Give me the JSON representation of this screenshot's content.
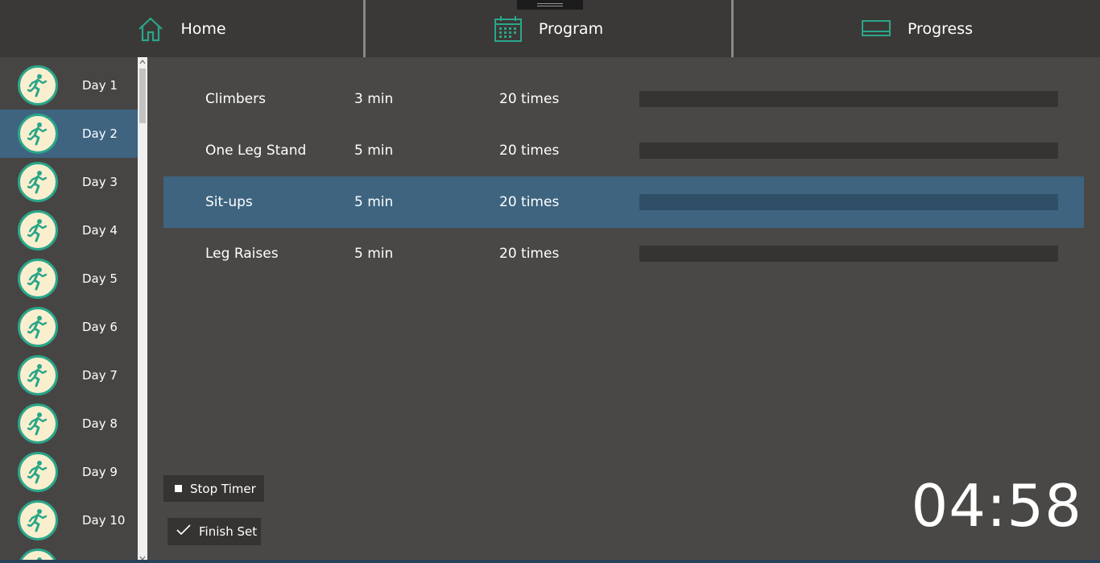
{
  "nav": {
    "tabs": [
      {
        "label": "Home",
        "icon": "home-icon"
      },
      {
        "label": "Program",
        "icon": "calendar-icon"
      },
      {
        "label": "Progress",
        "icon": "progress-icon"
      }
    ],
    "accent_color": "#2aa68a"
  },
  "sidebar": {
    "selected_index": 1,
    "items": [
      {
        "label": "Day 1",
        "icon": "runner-icon"
      },
      {
        "label": "Day 2",
        "icon": "runner-icon"
      },
      {
        "label": "Day 3",
        "icon": "runner-icon"
      },
      {
        "label": "Day 4",
        "icon": "runner-icon"
      },
      {
        "label": "Day 5",
        "icon": "runner-icon"
      },
      {
        "label": "Day 6",
        "icon": "runner-icon"
      },
      {
        "label": "Day 7",
        "icon": "runner-icon"
      },
      {
        "label": "Day 8",
        "icon": "runner-icon"
      },
      {
        "label": "Day 9",
        "icon": "runner-icon"
      },
      {
        "label": "Day 10",
        "icon": "runner-icon"
      }
    ]
  },
  "exercises": {
    "selected_index": 2,
    "rows": [
      {
        "name": "Climbers",
        "duration": "3 min",
        "reps": "20 times",
        "progress": 0
      },
      {
        "name": "One Leg Stand",
        "duration": "5 min",
        "reps": "20 times",
        "progress": 0
      },
      {
        "name": "Sit-ups",
        "duration": "5 min",
        "reps": "20 times",
        "progress": 0
      },
      {
        "name": "Leg Raises",
        "duration": "5 min",
        "reps": "20 times",
        "progress": 0
      }
    ]
  },
  "controls": {
    "stop_label": "Stop Timer",
    "finish_label": "Finish Set"
  },
  "timer": {
    "display": "04:58"
  },
  "colors": {
    "selection": "#3e6480",
    "background": "#4a4846",
    "header": "#3b3937"
  }
}
